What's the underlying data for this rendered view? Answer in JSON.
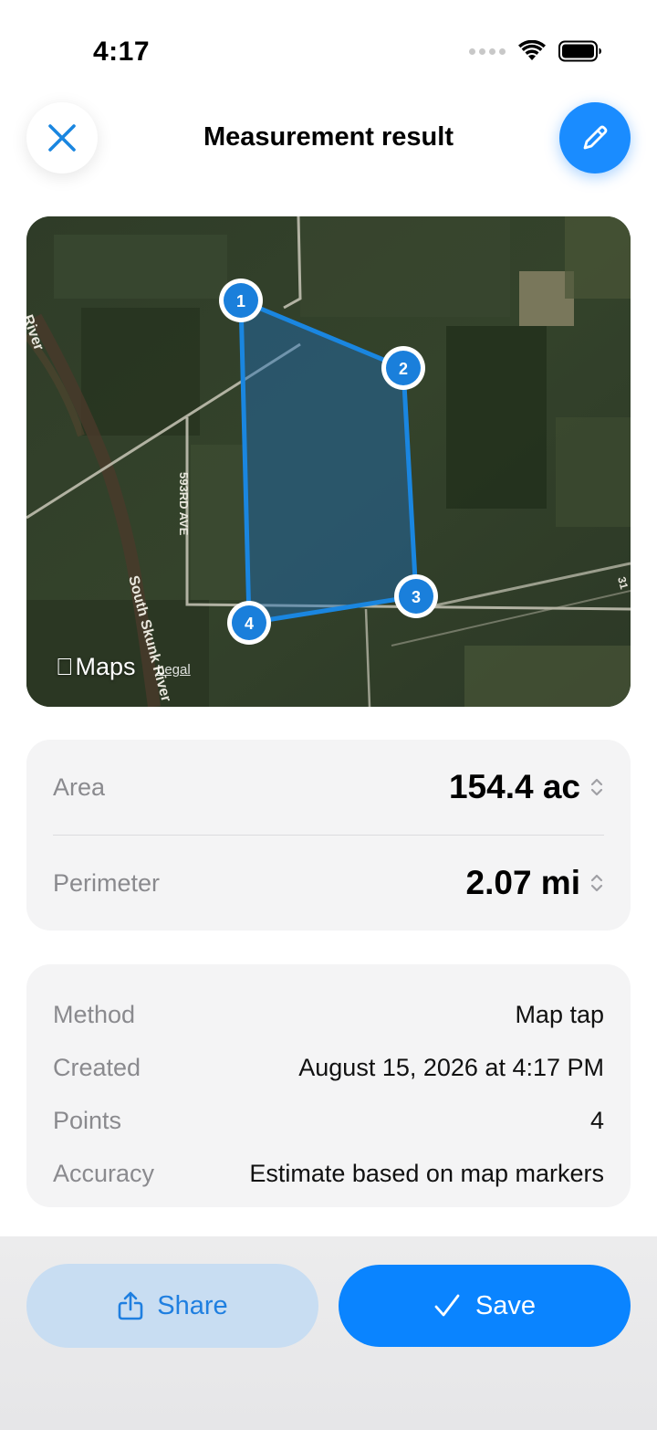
{
  "status_bar": {
    "time": "4:17",
    "icons": [
      "signal-dots-icon",
      "wifi-icon",
      "battery-icon"
    ]
  },
  "header": {
    "title": "Measurement result",
    "close_icon": "close-icon",
    "edit_icon": "pencil-icon"
  },
  "map": {
    "roads": [
      "593RD AVE",
      "South Skunk River",
      "River",
      "31"
    ],
    "markers": [
      "1",
      "2",
      "3",
      "4"
    ],
    "attribution": "Maps",
    "legal": "Legal",
    "polygon_color": "#1a86e0"
  },
  "measures": {
    "area_label": "Area",
    "area_value": "154.4 ac",
    "perimeter_label": "Perimeter",
    "perimeter_value": "2.07 mi"
  },
  "details": [
    {
      "label": "Method",
      "value": "Map tap"
    },
    {
      "label": "Created",
      "value": "August 15, 2026 at 4:17 PM"
    },
    {
      "label": "Points",
      "value": "4"
    },
    {
      "label": "Accuracy",
      "value": "Estimate based on map markers"
    }
  ],
  "actions": {
    "share_label": "Share",
    "save_label": "Save"
  },
  "colors": {
    "accent": "#0a84ff",
    "share_bg": "#c8ddf2",
    "card_bg": "#f4f4f5"
  }
}
